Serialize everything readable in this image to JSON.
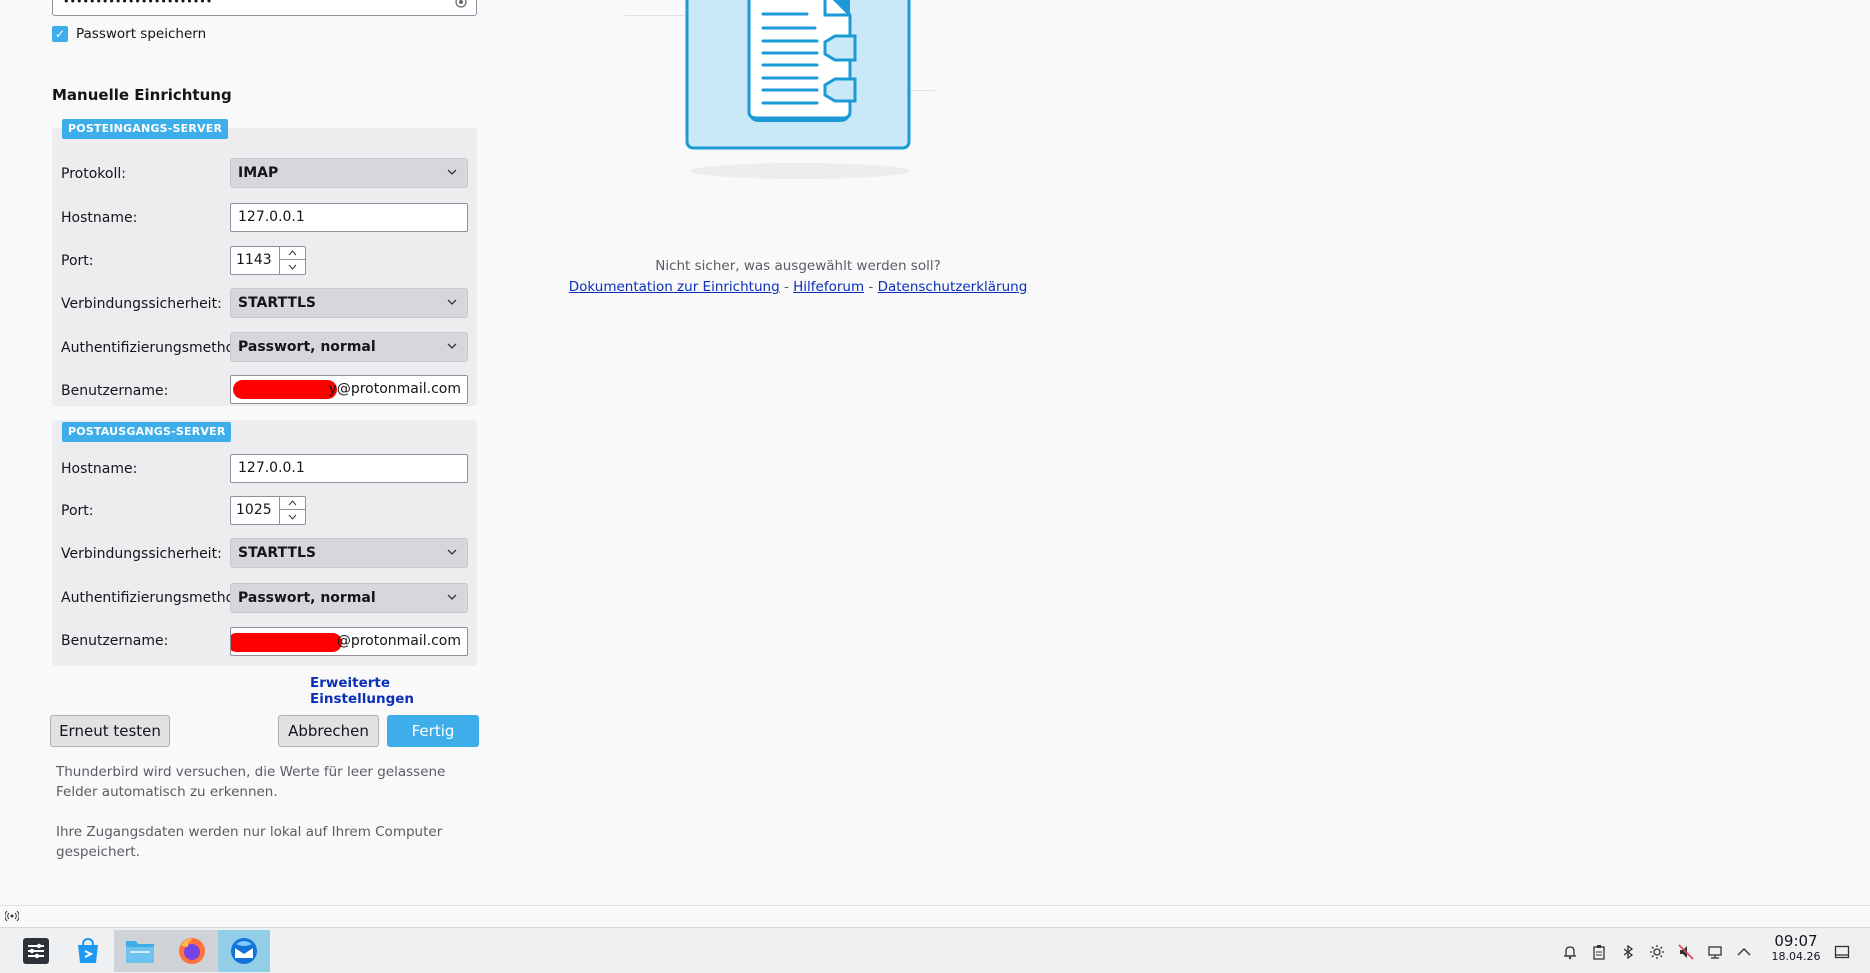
{
  "account": {
    "password_mask": "•••••••••••••••••••••••",
    "remember_password_label": "Passwort speichern",
    "remember_password_checked": true
  },
  "manual_setup": {
    "title": "Manuelle Einrichtung",
    "incoming": {
      "badge": "POSTEINGANGS-SERVER",
      "protocol_label": "Protokoll:",
      "protocol_value": "IMAP",
      "hostname_label": "Hostname:",
      "hostname_value": "127.0.0.1",
      "port_label": "Port:",
      "port_value": "1143",
      "security_label": "Verbindungssicherheit:",
      "security_value": "STARTTLS",
      "auth_label": "Authentifizierungsmethode:",
      "auth_value": "Passwort, normal",
      "username_label": "Benutzername:",
      "username_visible_suffix": "y@protonmail.com"
    },
    "outgoing": {
      "badge": "POSTAUSGANGS-SERVER",
      "hostname_label": "Hostname:",
      "hostname_value": "127.0.0.1",
      "port_label": "Port:",
      "port_value": "1025",
      "security_label": "Verbindungssicherheit:",
      "security_value": "STARTTLS",
      "auth_label": "Authentifizierungsmethode:",
      "auth_value": "Passwort, normal",
      "username_label": "Benutzername:",
      "username_visible_suffix": "@protonmail.com"
    },
    "advanced_link": "Erweiterte Einstellungen"
  },
  "buttons": {
    "retest": "Erneut testen",
    "cancel": "Abbrechen",
    "done": "Fertig"
  },
  "notes": {
    "autodetect": "Thunderbird wird versuchen, die Werte für leer gelassene Felder automatisch zu erkennen.",
    "local_storage": "Ihre Zugangsdaten werden nur lokal auf Ihrem Computer gespeichert."
  },
  "help": {
    "question": "Nicht sicher, was ausgewählt werden soll?",
    "docs_link": "Dokumentation zur Einrichtung",
    "separator": "-",
    "forum_link": "Hilfeforum",
    "privacy_link": "Datenschutzerklärung"
  },
  "taskbar": {
    "apps": [
      "system-settings-icon",
      "discover-icon",
      "dolphin-icon",
      "firefox-icon",
      "thunderbird-icon"
    ],
    "clock_time": "09:07",
    "clock_date": "18.04.26"
  },
  "colors": {
    "accent": "#3daee9",
    "link": "#0b2fb8",
    "redaction": "#ff0000"
  }
}
